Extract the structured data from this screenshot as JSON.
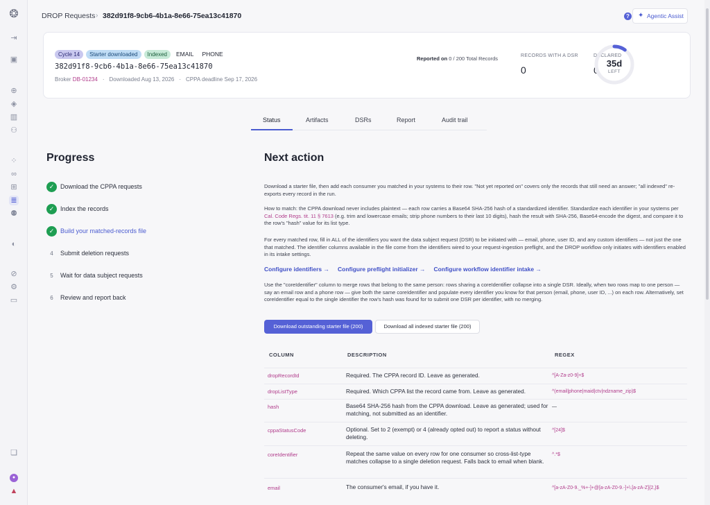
{
  "breadcrumb": {
    "root": "DROP Requests",
    "sep": "›",
    "current": "382d91f8-9cb6-4b1a-8e66-75ea13c41870"
  },
  "header_actions": {
    "help": "?",
    "assist_label": "Agentic Assist"
  },
  "summary": {
    "tags": [
      "Cycle 14",
      "Starter downloaded",
      "Indexed",
      "EMAIL",
      "PHONE"
    ],
    "record_id": "382d91f8-9cb6-4b1a-8e66-75ea13c41870",
    "broker_label": "Broker",
    "broker_id": "DB-01234",
    "downloaded": "Downloaded Aug 13, 2026",
    "deadline": "CPPA deadline Sep 17, 2026",
    "reported_label": "Reported on",
    "reported_value": "0 / 200 Total Records",
    "stats": [
      {
        "label": "RECORDS WITH A DSR",
        "value": "0"
      },
      {
        "label": "DECLARED",
        "value": "0"
      }
    ],
    "days_left": "35d",
    "days_left_label": "LEFT",
    "days_left_fraction": 0.1
  },
  "tabs": [
    "Status",
    "Artifacts",
    "DSRs",
    "Report",
    "Audit trail"
  ],
  "progress": {
    "title": "Progress",
    "steps": [
      {
        "mark": "✓",
        "label": "Download the CPPA requests"
      },
      {
        "mark": "✓",
        "label": "Index the records"
      },
      {
        "mark": "✓",
        "label": "Build your matched-records file"
      },
      {
        "mark": "4",
        "label": "Submit deletion requests"
      },
      {
        "mark": "5",
        "label": "Wait for data subject requests"
      },
      {
        "mark": "6",
        "label": "Review and report back"
      }
    ]
  },
  "next_action": {
    "title": "Next action",
    "p1": "Download a starter file, then add each consumer you matched in your systems to their row. \"Not yet reported on\" covers only the records that still need an answer; \"all indexed\" re-exports every record in the run.",
    "p2_a": "How to match: the CPPA download never includes plaintext — each row carries a Base64 SHA-256 hash of a standardized identifier. Standardize each identifier in your systems per ",
    "p2_link": "Cal. Code Regs. tit. 11 § 7613",
    "p2_b": " (e.g. trim and lowercase emails; strip phone numbers to their last 10 digits), hash the result with SHA-256, Base64-encode the digest, and compare it to the row's \"hash\" value for its list type.",
    "p3": "For every matched row, fill in ALL of the identifiers you want the data subject request (DSR) to be initiated with — email, phone, user ID, and any custom identifiers — not just the one that matched. The identifier columns available in the file come from the identifiers wired to your request-ingestion preflight, and the DROP workflow only initiates with identifiers enabled in its intake settings.",
    "links": [
      "Configure identifiers →",
      "Configure preflight initializer →",
      "Configure workflow identifier intake →"
    ],
    "p4": "Use the \"coreIdentifier\" column to merge rows that belong to the same person: rows sharing a coreIdentifier collapse into a single DSR. Ideally, when two rows map to one person — say an email row and a phone row — give both the same coreIdentifier and populate every identifier you know for that person (email, phone, user ID, ...) on each row. Alternatively, set coreIdentifier equal to the single identifier the row's hash was found for to submit one DSR per identifier, with no merging.",
    "btn_primary": "Download outstanding starter file (200)",
    "btn_secondary": "Download all indexed starter file (200)"
  },
  "table": {
    "headers": [
      "COLUMN",
      "DESCRIPTION",
      "REGEX"
    ],
    "rows": [
      {
        "column": "dropRecordId",
        "description": "Required. The CPPA record ID. Leave as generated.",
        "regex": "^[A-Za-z0-9]+$"
      },
      {
        "column": "dropListType",
        "description": "Required. Which CPPA list the record came from. Leave as generated.",
        "regex": "^(email|phone|maid|ctv|ndzname_zip)$"
      },
      {
        "column": "hash",
        "description": "Base64 SHA-256 hash from the CPPA download. Leave as generated; used for matching, not submitted as an identifier.",
        "regex": "—"
      },
      {
        "column": "cppaStatusCode",
        "description": "Optional. Set to 2 (exempt) or 4 (already opted out) to report a status without deleting.",
        "regex": "^[24]$"
      },
      {
        "column": "coreIdentifier",
        "description": "Repeat the same value on every row for one consumer so cross-list-type matches collapse to a single deletion request. Falls back to email when blank.",
        "regex": "^.*$"
      },
      {
        "column": "email",
        "description": "The consumer's email, if you have it.",
        "regex": "^[a-zA-Z0-9._%+-]+@[a-zA-Z0-9.-]+\\.[a-zA-Z]{2,}$"
      }
    ]
  }
}
